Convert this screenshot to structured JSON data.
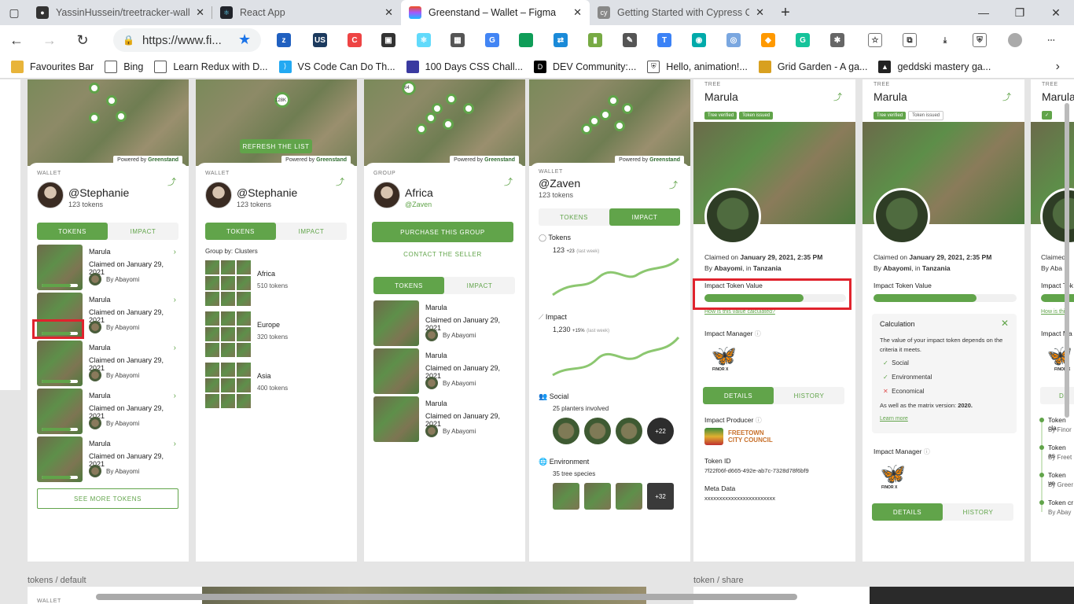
{
  "browser": {
    "tabs": [
      {
        "title": "YassinHussein/treetracker-wallet",
        "icon": "github-icon"
      },
      {
        "title": "React App",
        "icon": "react-icon"
      },
      {
        "title": "Greenstand – Wallet – Figma",
        "icon": "figma-icon",
        "active": true
      },
      {
        "title": "Getting Started with Cypress Con",
        "icon": "cypress-icon"
      }
    ],
    "url": "https://www.fi...",
    "bookmarks": [
      "Favourites Bar",
      "Bing",
      "Learn Redux with D...",
      "VS Code Can Do Th...",
      "100 Days CSS Chall...",
      "DEV Community:...",
      "Hello, animation!...",
      "Grid Garden - A ga...",
      "geddski mastery ga..."
    ]
  },
  "common": {
    "powered": "Powered by",
    "greenstand": "Greenstand",
    "tree_name": "Marula",
    "claimed": "Claimed on January 29, 2021",
    "by": "By Abayomi",
    "tokens_tab": "TOKENS",
    "impact_tab": "IMPACT"
  },
  "frame1": {
    "label": "WALLET",
    "name": "@Stephanie",
    "tokens": "123 tokens",
    "see_more": "SEE MORE TOKENS"
  },
  "frame2": {
    "refresh": "REFRESH THE LIST",
    "pin_count": "128K",
    "label": "WALLET",
    "name": "@Stephanie",
    "tokens": "123 tokens",
    "group_by": "Group by: Clusters",
    "groups": [
      {
        "name": "Africa",
        "tokens": "510 tokens"
      },
      {
        "name": "Europe",
        "tokens": "320 tokens"
      },
      {
        "name": "Asia",
        "tokens": "400 tokens"
      }
    ]
  },
  "frame3": {
    "pin_count": "64",
    "label": "GROUP",
    "name": "Africa",
    "handle": "@Zaven",
    "purchase": "PURCHASE THIS GROUP",
    "contact": "CONTACT THE SELLER"
  },
  "frame4": {
    "label": "WALLET",
    "name": "@Zaven",
    "tokens": "123 tokens",
    "tokens_title": "Tokens",
    "tokens_value": "123",
    "tokens_delta": "+23",
    "last_week": "(last week)",
    "impact_title": "Impact",
    "impact_value": "1,230",
    "impact_delta": "+15%",
    "social_title": "Social",
    "social_sub": "25 planters involved",
    "social_more": "+22",
    "env_title": "Environment",
    "env_sub": "35 tree species",
    "env_more": "+32"
  },
  "frame5": {
    "label": "TREE",
    "name": "Marula",
    "chip1": "Tree verified",
    "chip2": "Token issued",
    "claimed_prefix": "Claimed on",
    "claimed_date": "January 29, 2021, 2:35 PM",
    "by_prefix": "By",
    "by_name": "Abayomi",
    "in_text": ", in",
    "country": "Tanzania",
    "impact_value_title": "Impact Token Value",
    "impact_value_pct": 70,
    "calc_link": "How is this value calculated?",
    "manager": "Impact Manager",
    "details": "DETAILS",
    "history": "HISTORY",
    "producer": "Impact Producer",
    "producer_name_1": "FREETOWN",
    "producer_name_2": "CITY COUNCIL",
    "token_id_title": "Token ID",
    "token_id": "7f22f06f-d665-492e-ab7c-7328d78f6bf9",
    "meta_title": "Meta Data",
    "meta": "xxxxxxxxxxxxxxxxxxxxxxxx",
    "finor": "FINOR X"
  },
  "frame6": {
    "label": "TREE",
    "name": "Marula",
    "chip1": "Tree verified",
    "chip2": "Token issued",
    "impact_value_title": "Impact Token Value",
    "impact_value_pct": 72,
    "calc_title": "Calculation",
    "calc_text": "The value of your impact token depends on the criteria it meets.",
    "criteria": [
      {
        "name": "Social",
        "met": true
      },
      {
        "name": "Environmental",
        "met": true
      },
      {
        "name": "Economical",
        "met": false
      }
    ],
    "matrix_prefix": "As well as the matrix version:",
    "matrix_version": "2020.",
    "learn_more": "Learn more",
    "manager": "Impact Manager",
    "details": "DETAILS",
    "history": "HISTORY"
  },
  "frame7": {
    "label": "TREE",
    "name": "Marula",
    "claimed": "Claimed",
    "by": "By Aba",
    "impact": "Impact Tok",
    "link": "How is this",
    "manager": "Impact Ma",
    "details": "DE",
    "timeline": [
      {
        "title": "Token cla",
        "sub": "By Finor"
      },
      {
        "title": "Token as",
        "sub": "By Freet"
      },
      {
        "title": "Token ve",
        "sub": "By Greer"
      },
      {
        "title": "Token cr",
        "sub": "By Abay"
      }
    ]
  },
  "bottom": {
    "label_left": "tokens / default",
    "label_right": "token / share",
    "wallet_small": "WALLET"
  }
}
